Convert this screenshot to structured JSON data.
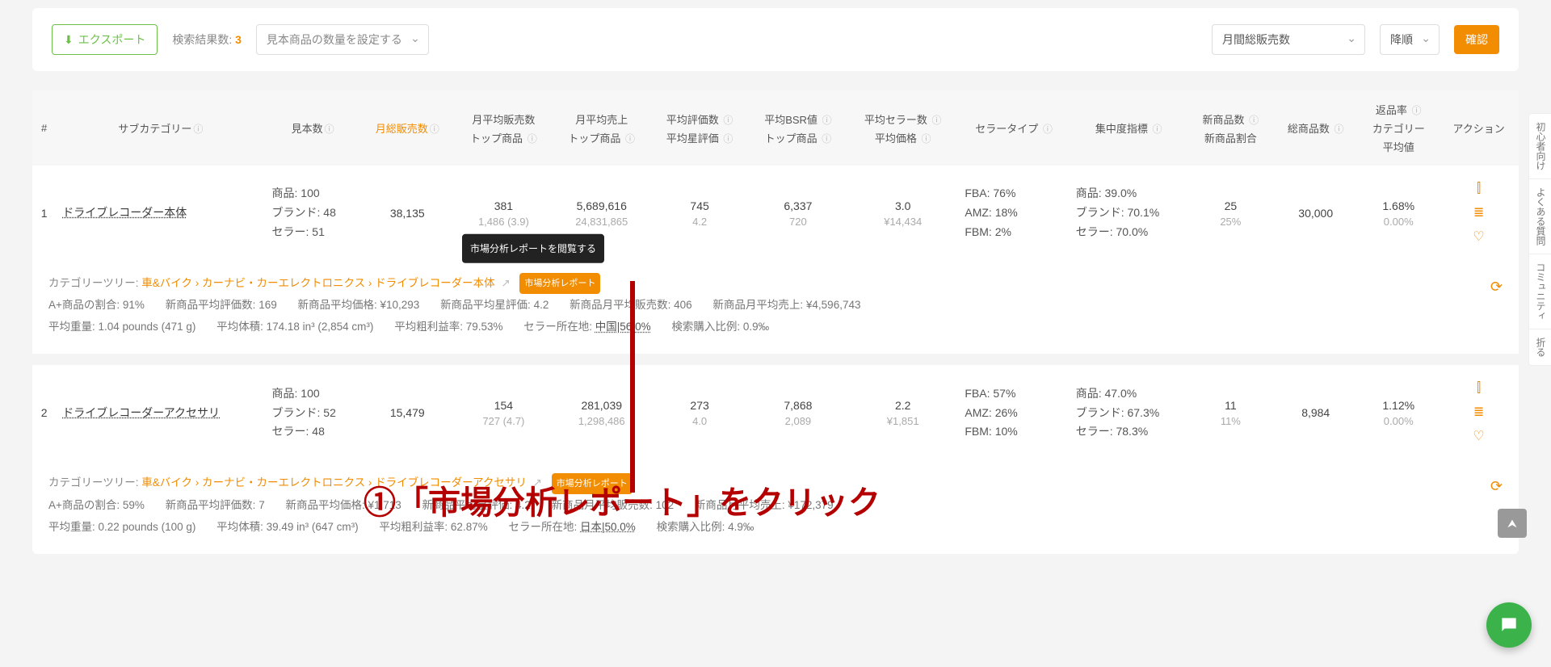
{
  "toolbar": {
    "export_label": "エクスポート",
    "results_label": "検索結果数:",
    "results_count": "3",
    "sample_setting_placeholder": "見本商品の数量を設定する",
    "sort_field": "月間総販売数",
    "sort_order": "降順",
    "confirm": "確認"
  },
  "headers": {
    "idx": "#",
    "subcat": "サブカテゴリー",
    "sample": "見本数",
    "monthly_sales": "月総販売数",
    "avg_monthly_sales": "月平均販売数",
    "top_products": "トップ商品",
    "avg_monthly_rev": "月平均売上",
    "avg_reviews": "平均評価数",
    "avg_star": "平均星評価",
    "avg_bsr": "平均BSR値",
    "avg_sellers": "平均セラー数",
    "avg_price": "平均価格",
    "seller_type": "セラータイプ",
    "conc": "集中度指標",
    "new_count": "新商品数",
    "new_ratio": "新商品割合",
    "total_products": "総商品数",
    "return_rate": "返品率",
    "category": "カテゴリー",
    "avg": "平均値",
    "action": "アクション"
  },
  "rows": [
    {
      "idx": "1",
      "subcat": "ドライブレコーダー本体",
      "sample": {
        "products": "商品: 100",
        "brands": "ブランド: 48",
        "sellers": "セラー: 51"
      },
      "monthly_sales": "38,135",
      "avg_monthly_sales": {
        "main": "381",
        "sub": "1,486 (3.9)"
      },
      "avg_monthly_rev": {
        "main": "5,689,616",
        "sub": "24,831,865"
      },
      "avg_reviews": {
        "main": "745",
        "sub": "4.2"
      },
      "avg_bsr": {
        "main": "6,337",
        "sub": "720"
      },
      "avg_sellers": {
        "main": "3.0",
        "sub": "¥14,434"
      },
      "seller_type": {
        "fba": "FBA: 76%",
        "amz": "AMZ: 18%",
        "fbm": "FBM: 2%"
      },
      "conc": {
        "products": "商品: 39.0%",
        "brands": "ブランド: 70.1%",
        "sellers": "セラー: 70.0%"
      },
      "new": {
        "count": "25",
        "ratio": "25%"
      },
      "total_products": "30,000",
      "return": {
        "rate": "1.68%",
        "cat": "0.00%"
      },
      "meta": {
        "cat_tree_label": "カテゴリーツリー:",
        "cat_tree_path": "車&バイク › カーナビ・カーエレクトロニクス › ドライブレコーダー本体",
        "report_badge": "市場分析レポート",
        "tooltip": "市場分析レポートを閲覧する",
        "aplus": "A+商品の割合: 91%",
        "new_reviews": "新商品平均評価数: 169",
        "new_price": "新商品平均価格: ¥10,293",
        "new_star": "新商品平均星評価: 4.2",
        "new_msales": "新商品月平均販売数: 406",
        "new_mrev": "新商品月平均売上: ¥4,596,743",
        "avg_weight": "平均重量: 1.04 pounds (471 g)",
        "avg_vol": "平均体積: 174.18 in³ (2,854 cm³)",
        "avg_margin": "平均粗利益率: 79.53%",
        "seller_loc_label": "セラー所在地:",
        "seller_loc_val": "中国|56.0%",
        "search_buy": "検索購入比例: 0.9‰"
      }
    },
    {
      "idx": "2",
      "subcat": "ドライブレコーダーアクセサリ",
      "sample": {
        "products": "商品: 100",
        "brands": "ブランド: 52",
        "sellers": "セラー: 48"
      },
      "monthly_sales": "15,479",
      "avg_monthly_sales": {
        "main": "154",
        "sub": "727 (4.7)"
      },
      "avg_monthly_rev": {
        "main": "281,039",
        "sub": "1,298,486"
      },
      "avg_reviews": {
        "main": "273",
        "sub": "4.0"
      },
      "avg_bsr": {
        "main": "7,868",
        "sub": "2,089"
      },
      "avg_sellers": {
        "main": "2.2",
        "sub": "¥1,851"
      },
      "seller_type": {
        "fba": "FBA: 57%",
        "amz": "AMZ: 26%",
        "fbm": "FBM: 10%"
      },
      "conc": {
        "products": "商品: 47.0%",
        "brands": "ブランド: 67.3%",
        "sellers": "セラー: 78.3%"
      },
      "new": {
        "count": "11",
        "ratio": "11%"
      },
      "total_products": "8,984",
      "return": {
        "rate": "1.12%",
        "cat": "0.00%"
      },
      "meta": {
        "cat_tree_label": "カテゴリーツリー:",
        "cat_tree_path": "車&バイク › カーナビ・カーエレクトロニクス › ドライブレコーダーアクセサリ",
        "report_badge": "市場分析レポート",
        "aplus": "A+商品の割合: 59%",
        "new_reviews": "新商品平均評価数: 7",
        "new_price": "新商品平均価格: ¥1,713",
        "new_star": "新商品平均星評価: 4.2",
        "new_msales": "新商品月平均販売数: 102",
        "new_mrev": "新商品月平均売上: ¥172,379",
        "avg_weight": "平均重量: 0.22 pounds (100 g)",
        "avg_vol": "平均体積: 39.49 in³ (647 cm³)",
        "avg_margin": "平均粗利益率: 62.87%",
        "seller_loc_label": "セラー所在地:",
        "seller_loc_val": "日本|50.0%",
        "search_buy": "検索購入比例: 4.9‰"
      }
    }
  ],
  "side_rail": {
    "beginner": "初心者向け",
    "faq": "よくある質問",
    "community": "コミュニティ",
    "fold": "折る"
  },
  "overlay": {
    "line1": "①「市場分析レポート」をクリック"
  },
  "icons": {
    "download": "⬇",
    "external": "↗",
    "chart": "⫿",
    "list": "≣",
    "heart": "♡",
    "refresh": "⟳",
    "up": "⮝",
    "chat": "💬"
  }
}
